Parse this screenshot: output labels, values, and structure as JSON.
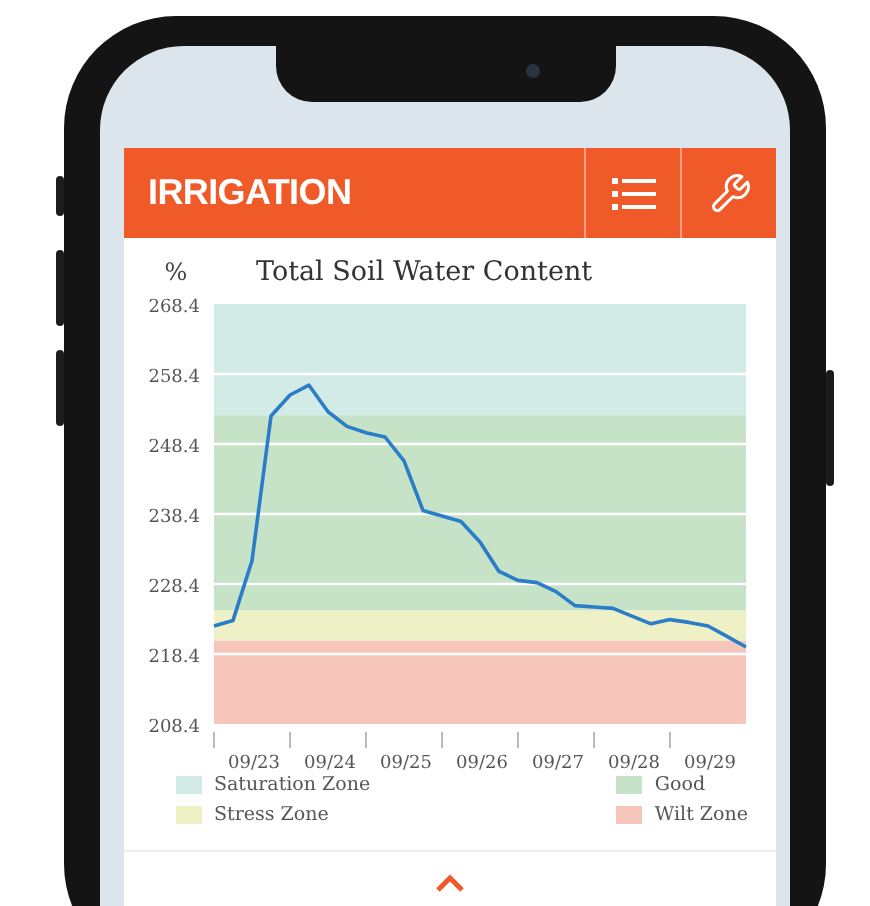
{
  "app_bar": {
    "title": "IRRIGATION"
  },
  "chart": {
    "chart_data": {
      "type": "line",
      "title": "Total Soil Water Content",
      "ylabel": "%",
      "categories": [
        null,
        null,
        "09/23",
        null,
        null,
        null,
        "09/24",
        null,
        null,
        null,
        "09/25",
        null,
        null,
        null,
        "09/26",
        null,
        null,
        null,
        "09/27",
        null,
        null,
        null,
        "09/28",
        null,
        null,
        null,
        "09/29",
        null,
        null
      ],
      "series": [
        {
          "color": "#2b7cc9",
          "values": [
            222.4,
            223.2,
            231.7,
            252.4,
            255.4,
            256.8,
            253.0,
            250.9,
            250.0,
            249.4,
            246.0,
            238.9,
            238.1,
            237.3,
            234.4,
            230.2,
            228.9,
            228.6,
            227.3,
            225.3,
            225.1,
            224.9,
            223.8,
            222.7,
            223.3,
            222.9,
            222.4,
            220.9,
            219.4
          ]
        }
      ],
      "ylim": [
        208.4,
        268.4
      ],
      "grid": true,
      "yticks": [
        208.4,
        218.4,
        228.4,
        238.4,
        248.4,
        258.4,
        268.4
      ],
      "bands": [
        {
          "axis": "y",
          "from": 252.5,
          "to": 268.4,
          "color": "#d3ebe6"
        },
        {
          "axis": "y",
          "from": 224.6,
          "to": 252.5,
          "color": "#c6e3c8"
        },
        {
          "axis": "y",
          "from": 220.3,
          "to": 224.6,
          "color": "#eef0c5"
        },
        {
          "axis": "y",
          "from": 208.4,
          "to": 220.3,
          "color": "#f6c6bb"
        }
      ]
    }
  },
  "legend": [
    {
      "label": "Saturation Zone",
      "color": "#d3ebe6"
    },
    {
      "label": "Good",
      "color": "#c6e3c8"
    },
    {
      "label": "Stress Zone",
      "color": "#eef0c5"
    },
    {
      "label": "Wilt Zone",
      "color": "#f6c6bb"
    }
  ]
}
